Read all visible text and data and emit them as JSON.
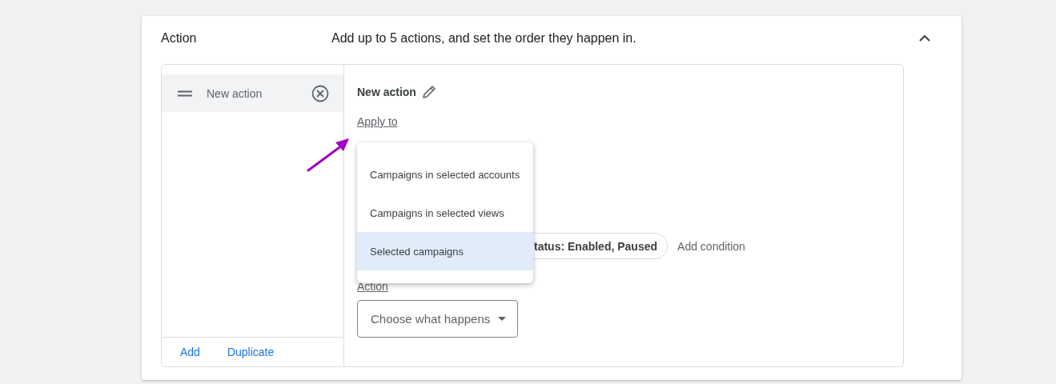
{
  "section": {
    "title": "Action",
    "description": "Add up to 5 actions, and set the order they happen in.",
    "expanded": true
  },
  "action_list": {
    "items": [
      {
        "label": "New action",
        "selected": true
      }
    ],
    "links": [
      "Add",
      "Duplicate"
    ]
  },
  "editor": {
    "title": "New action",
    "apply_to_label": "Apply to",
    "apply_to_menu": {
      "options": [
        {
          "label": "Campaigns in selected accounts",
          "selected": false
        },
        {
          "label": "Campaigns in selected views",
          "selected": false
        },
        {
          "label": "Selected campaigns",
          "selected": true
        }
      ]
    },
    "conditions": {
      "chip": "tatus: Enabled, Paused",
      "add_link": "Add condition"
    },
    "action_label": "Action",
    "action_select": {
      "placeholder": "Choose what happens"
    }
  }
}
